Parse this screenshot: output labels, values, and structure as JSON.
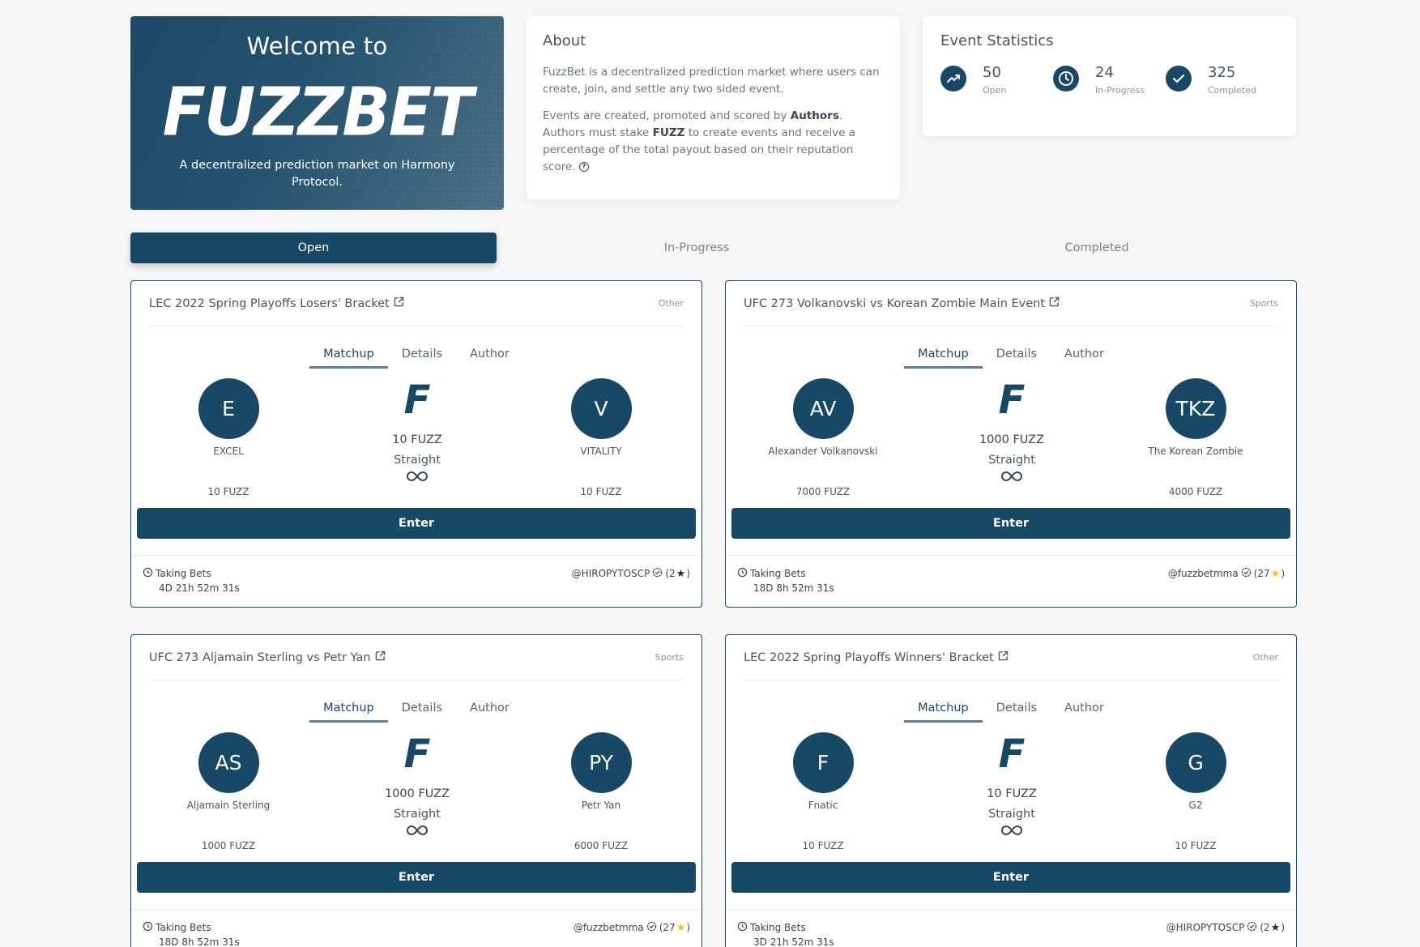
{
  "hero": {
    "welcome": "Welcome to",
    "logo": "FUZZBET",
    "tagline": "A decentralized prediction market on Harmony Protocol."
  },
  "about": {
    "title": "About",
    "para1": "FuzzBet is a decentralized prediction market where users can create, join, and settle any two sided event.",
    "para2_a": "Events are created, promoted and scored by ",
    "para2_authors": "Authors",
    "para2_b": ". Authors must stake ",
    "para2_fuzz": "FUZZ",
    "para2_c": " to create events and receive a percentage of the total payout based on their reputation score. "
  },
  "stats": {
    "title": "Event Statistics",
    "items": [
      {
        "value": "50",
        "label": "Open",
        "icon": "trending-up-icon"
      },
      {
        "value": "24",
        "label": "In-Progress",
        "icon": "clock-icon"
      },
      {
        "value": "325",
        "label": "Completed",
        "icon": "check-icon"
      }
    ]
  },
  "tabs": [
    "Open",
    "In-Progress",
    "Completed"
  ],
  "subtabs": [
    "Matchup",
    "Details",
    "Author"
  ],
  "labels": {
    "enter": "Enter",
    "taking_bets": "Taking Bets",
    "f_logo": "F",
    "bet_type": "Straight"
  },
  "events": [
    {
      "title": "LEC 2022 Spring Playoffs Losers' Bracket",
      "category": "Other",
      "left": {
        "initials": "E",
        "name": "EXCEL",
        "stake": "10 FUZZ"
      },
      "right": {
        "initials": "V",
        "name": "VITALITY",
        "stake": "10 FUZZ"
      },
      "pot": "10 FUZZ",
      "timer": "4D 21h 52m 31s",
      "author": "@HIROPYTOSCP",
      "rep_open": "(2",
      "rep_close": ")",
      "star_color": "#1b2a3a"
    },
    {
      "title": "UFC 273 Volkanovski vs Korean Zombie Main Event",
      "category": "Sports",
      "left": {
        "initials": "AV",
        "name": "Alexander Volkanovski",
        "stake": "7000 FUZZ"
      },
      "right": {
        "initials": "TKZ",
        "name": "The Korean Zombie",
        "stake": "4000 FUZZ"
      },
      "pot": "1000 FUZZ",
      "timer": "18D 8h 52m 31s",
      "author": "@fuzzbetmma",
      "rep_open": "(27",
      "rep_close": ")",
      "star_color": "#f2c21b"
    },
    {
      "title": "UFC 273 Aljamain Sterling vs Petr Yan",
      "category": "Sports",
      "left": {
        "initials": "AS",
        "name": "Aljamain Sterling",
        "stake": "1000 FUZZ"
      },
      "right": {
        "initials": "PY",
        "name": "Petr Yan",
        "stake": "6000 FUZZ"
      },
      "pot": "1000 FUZZ",
      "timer": "18D 8h 52m 31s",
      "author": "@fuzzbetmma",
      "rep_open": "(27",
      "rep_close": ")",
      "star_color": "#f2c21b"
    },
    {
      "title": "LEC 2022 Spring Playoffs Winners' Bracket",
      "category": "Other",
      "left": {
        "initials": "F",
        "name": "Fnatic",
        "stake": "10 FUZZ"
      },
      "right": {
        "initials": "G",
        "name": "G2",
        "stake": "10 FUZZ"
      },
      "pot": "10 FUZZ",
      "timer": "3D 21h 52m 31s",
      "author": "@HIROPYTOSCP",
      "rep_open": "(2",
      "rep_close": ")",
      "star_color": "#1b2a3a"
    }
  ]
}
